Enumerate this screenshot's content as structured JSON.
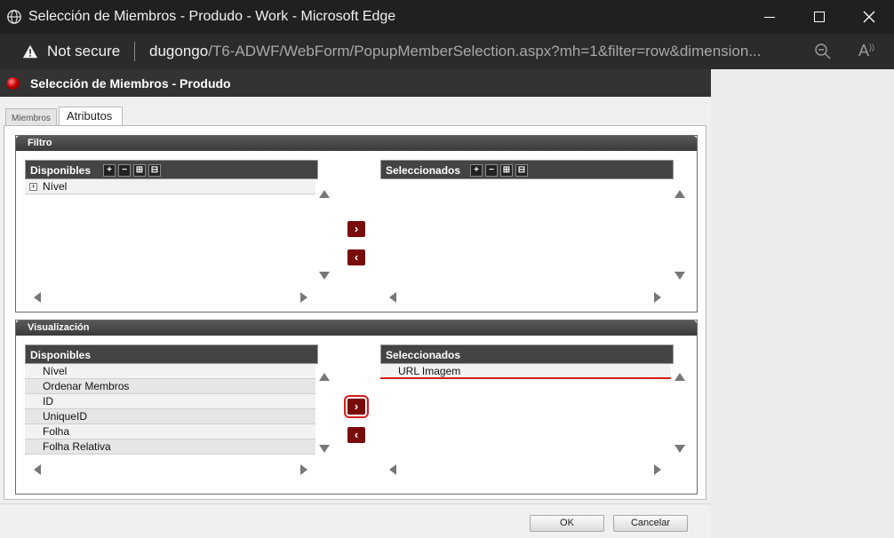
{
  "browser": {
    "window_title": "Selección de Miembros - Produdo - Work - Microsoft Edge",
    "security_label": "Not secure",
    "url_host": "dugongo",
    "url_path": "/T6-ADWF/WebForm/PopupMemberSelection.aspx?mh=1&filter=row&dimension..."
  },
  "popup": {
    "title": "Selección de Miembros - Produdo",
    "tabs": [
      {
        "label": "Miembros",
        "active": false
      },
      {
        "label": "Atributos",
        "active": true
      }
    ]
  },
  "filtro": {
    "header": "Filtro",
    "available_title": "Disponibles",
    "selected_title": "Seleccionados",
    "available_items": [
      "Nível"
    ],
    "selected_items": []
  },
  "visualizacion": {
    "header": "Visualización",
    "available_title": "Disponibles",
    "selected_title": "Seleccionados",
    "available_items": [
      "Nível",
      "Ordenar Membros",
      "ID",
      "UniqueID",
      "Folha",
      "Folha Relativa"
    ],
    "selected_items": [
      "URL Imagem"
    ]
  },
  "footer": {
    "ok_label": "OK",
    "cancel_label": "Cancelar"
  },
  "colors": {
    "accent": "#7a0b0b",
    "highlight": "#d81b1b",
    "header_dark": "#333333"
  }
}
